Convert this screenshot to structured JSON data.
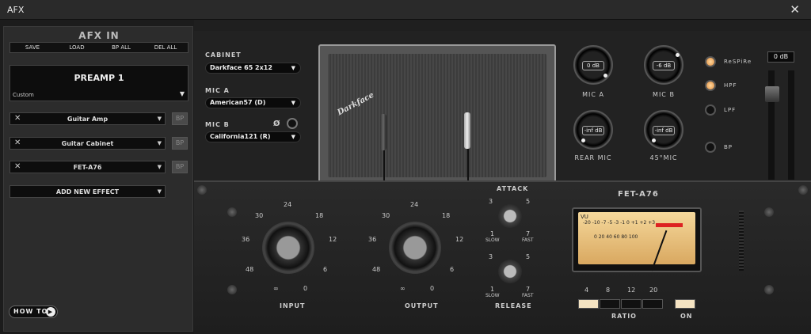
{
  "window": {
    "title": "AFX",
    "close": "✕"
  },
  "left": {
    "title": "AFX IN",
    "toolbar": [
      "SAVE",
      "LOAD",
      "BP ALL",
      "DEL ALL"
    ],
    "preset": {
      "name": "PREAMP 1",
      "type": "Custom"
    },
    "slots": [
      {
        "label": "Guitar Amp"
      },
      {
        "label": "Guitar Cabinet"
      },
      {
        "label": "FET-A76"
      }
    ],
    "bp_label": "BP",
    "remove": "✕",
    "add": "ADD NEW EFFECT",
    "howto": "HOW TO"
  },
  "cabinet": {
    "cab_label": "CABINET",
    "cab_value": "Darkface 65 2x12",
    "mica_label": "MIC A",
    "mica_value": "American57 (D)",
    "micb_label": "MIC B",
    "micb_value": "California121 (R)",
    "phase": "Ø",
    "logo": "Darkface",
    "knobs": [
      {
        "label": "MIC A",
        "value": "0 dB"
      },
      {
        "label": "MIC B",
        "value": "-6 dB"
      },
      {
        "label": "REAR MIC",
        "value": "-inf dB"
      },
      {
        "label": "45°MIC",
        "value": "-inf dB"
      }
    ],
    "filters": [
      {
        "label": "ReSPiRe",
        "on": true
      },
      {
        "label": "HPF",
        "on": true
      },
      {
        "label": "LPF",
        "on": false
      },
      {
        "label": "BP",
        "on": false
      }
    ],
    "output": "0 dB"
  },
  "fet": {
    "title": "FET-A76",
    "input_label": "INPUT",
    "output_label": "OUTPUT",
    "input_ticks": [
      "24",
      "18",
      "12",
      "6",
      "0",
      "∞",
      "48",
      "36",
      "30"
    ],
    "output_ticks": [
      "24",
      "18",
      "12",
      "6",
      "0",
      "∞",
      "48",
      "36",
      "30"
    ],
    "attack_label": "ATTACK",
    "release_label": "RELEASE",
    "scale": {
      "a3": "3",
      "a5": "5",
      "a1": "1",
      "a7": "7",
      "slow": "SLOW",
      "fast": "FAST"
    },
    "vu_labels": {
      "vu": "VU",
      "top": "-20 -10 -7 -5 -3 -1 0 +1 +2 +3",
      "bottom": "0 20 40 60 80 100"
    },
    "ratio_label": "RATIO",
    "ratios": [
      "4",
      "8",
      "12",
      "20"
    ],
    "ratio_on": 0,
    "on_label": "ON"
  }
}
